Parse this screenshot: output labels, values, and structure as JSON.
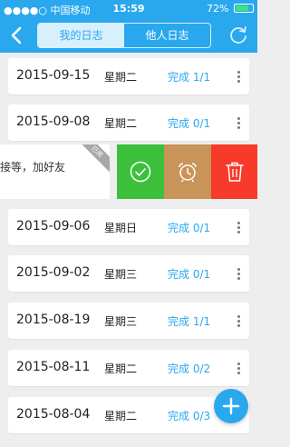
{
  "status_bar": {
    "carrier": "●●●●○ 中国移动",
    "time": "15:59",
    "battery_text": "72%"
  },
  "nav": {
    "tabs": [
      {
        "label": "我的日志",
        "active": true
      },
      {
        "label": "他人日志",
        "active": false
      }
    ]
  },
  "entries": [
    {
      "date": "2015-09-15",
      "weekday": "星期二",
      "status": "完成 1/1"
    },
    {
      "date": "2015-09-08",
      "weekday": "星期二",
      "status": "完成 0/1"
    },
    {
      "date": "2015-09-06",
      "weekday": "星期日",
      "status": "完成 0/1"
    },
    {
      "date": "2015-09-02",
      "weekday": "星期三",
      "status": "完成 0/1"
    },
    {
      "date": "2015-08-19",
      "weekday": "星期三",
      "status": "完成 1/1"
    },
    {
      "date": "2015-08-11",
      "weekday": "星期二",
      "status": "完成 0/2"
    },
    {
      "date": "2015-08-04",
      "weekday": "星期二",
      "status": "完成 0/3"
    }
  ],
  "swiped_item": {
    "text": "接等，加好友",
    "ribbon": "已阅"
  },
  "colors": {
    "primary": "#2aa8ee",
    "done_action": "#3cc03c",
    "remind_action": "#c8945a",
    "delete_action": "#f83a2a"
  },
  "icons": {
    "back": "chevron-left-icon",
    "refresh": "refresh-icon",
    "done": "check-circle-icon",
    "remind": "alarm-clock-icon",
    "delete": "trash-icon",
    "add": "plus-icon",
    "more": "more-vertical-icon"
  }
}
